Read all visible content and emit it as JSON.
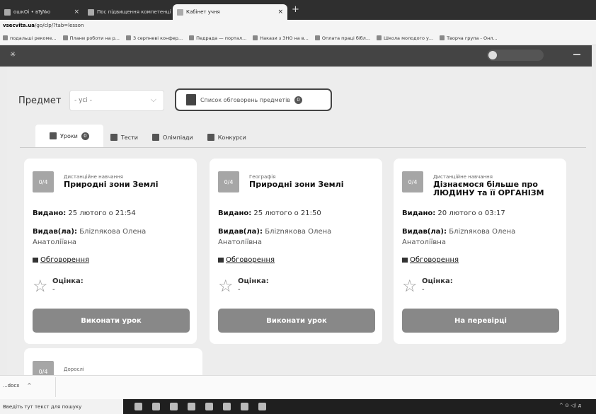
{
  "browser": {
    "tabs": [
      {
        "label": "ошкОі • вЂ№о  ",
        "active": false
      },
      {
        "label": "Пос підвищення компетенції ",
        "active": false
      },
      {
        "label": "Кабінет учня",
        "active": true
      }
    ],
    "url_prefix": "",
    "url_domain": "vsecvita.ua",
    "url_path": "/go/clp/?tab=lesson",
    "bookmarks": [
      "подальші рекоме...",
      "Плани роботи на р...",
      "3 серпневі конфер...",
      "Педрада — портал...",
      "Накази з ЗНО на в...",
      "Оплата праці бібл...",
      "Школа молодого у...",
      "Творча група - Онл..."
    ]
  },
  "filter": {
    "subject_label": "Предмет",
    "subject_value": "- усі -",
    "discussions_button": "Список обговорень предметів",
    "discussions_count": "0"
  },
  "tabs": [
    {
      "label": "Уроки",
      "count": "0",
      "active": true
    },
    {
      "label": "Тести",
      "count": "",
      "active": false
    },
    {
      "label": "Олімпіади",
      "count": "",
      "active": false
    },
    {
      "label": "Конкурси",
      "count": "",
      "active": false
    }
  ],
  "labels": {
    "issued": "Видано:",
    "issued_by": "Видав(ла):",
    "discussion": "Обговорення",
    "grade": "Оцінка:"
  },
  "lessons": [
    {
      "score": "0/4",
      "category": "Дистанційне навчання",
      "title": "Природні зони Землі",
      "issued": "25 лютого о 21:54",
      "author": "Бліznякова Олена Анатоліївна",
      "grade": "-",
      "action": "Виконати урок"
    },
    {
      "score": "0/4",
      "category": "Географія",
      "title": "Природні зони Землі",
      "issued": "25 лютого о 21:50",
      "author": "Бліznякова Олена Анатоліївна",
      "grade": "-",
      "action": "Виконати урок"
    },
    {
      "score": "0/4",
      "category": "Дистанційне навчання",
      "title": "Дізнаємося більше про ЛЮДИНУ та її ОРГАНІЗМ",
      "issued": "20 лютого о 03:17",
      "author": "Бліznякова Олена Анатоліївна",
      "grade": "-",
      "action": "На перевірці"
    },
    {
      "score": "0/4",
      "category": "Дорослі",
      "title": "",
      "issued": "",
      "author": "",
      "grade": "",
      "action": ""
    }
  ],
  "downloads": {
    "item": "...docx",
    "chevron": "^"
  },
  "taskbar": {
    "search_placeholder": "Введіть тут текст для пошуку",
    "tray": "^ ⊙ ◁) д"
  }
}
